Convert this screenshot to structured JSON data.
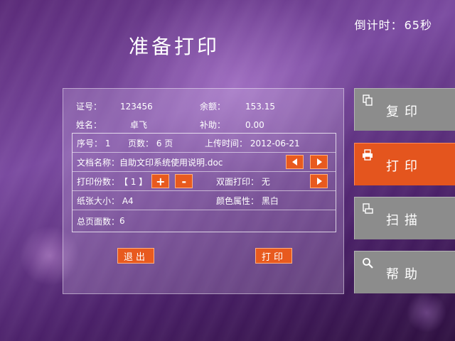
{
  "countdown": {
    "label": "倒计时：",
    "value": "65秒"
  },
  "title": "准备打印",
  "user": {
    "id_label": "证号：",
    "id_value": "123456",
    "balance_label": "余额：",
    "balance_value": "153.15",
    "name_label": "姓名：",
    "name_value": "卓飞",
    "subsidy_label": "补助：",
    "subsidy_value": "0.00"
  },
  "document": {
    "seq_label": "序号：",
    "seq_value": "1",
    "pages_label": "页数：",
    "pages_value": "6 页",
    "upload_label": "上传时间：",
    "upload_value": "2012-06-21",
    "name_label": "文档名称：",
    "name_value": "自助文印系统使用说明.doc",
    "copies_label": "打印份数：",
    "copies_value": "【 1 】",
    "plus_label": "+",
    "minus_label": "-",
    "duplex_label": "双面打印：",
    "duplex_value": "无",
    "paper_label": "纸张大小：",
    "paper_value": "A4",
    "color_label": "颜色属性：",
    "color_value": "黑白",
    "total_label": "总页面数：",
    "total_value": "6"
  },
  "actions": {
    "exit_label": "退出",
    "print_label": "打印"
  },
  "sidebar": {
    "items": [
      {
        "label": "复印",
        "icon": "copy-icon",
        "active": false
      },
      {
        "label": "打印",
        "icon": "printer-icon",
        "active": true
      },
      {
        "label": "扫描",
        "icon": "scan-icon",
        "active": false
      },
      {
        "label": "帮助",
        "icon": "search-icon",
        "active": false
      }
    ]
  },
  "colors": {
    "accent": "#e85a1e",
    "sidebar_inactive": "#8c8c8c",
    "sidebar_active": "#e4551e"
  }
}
